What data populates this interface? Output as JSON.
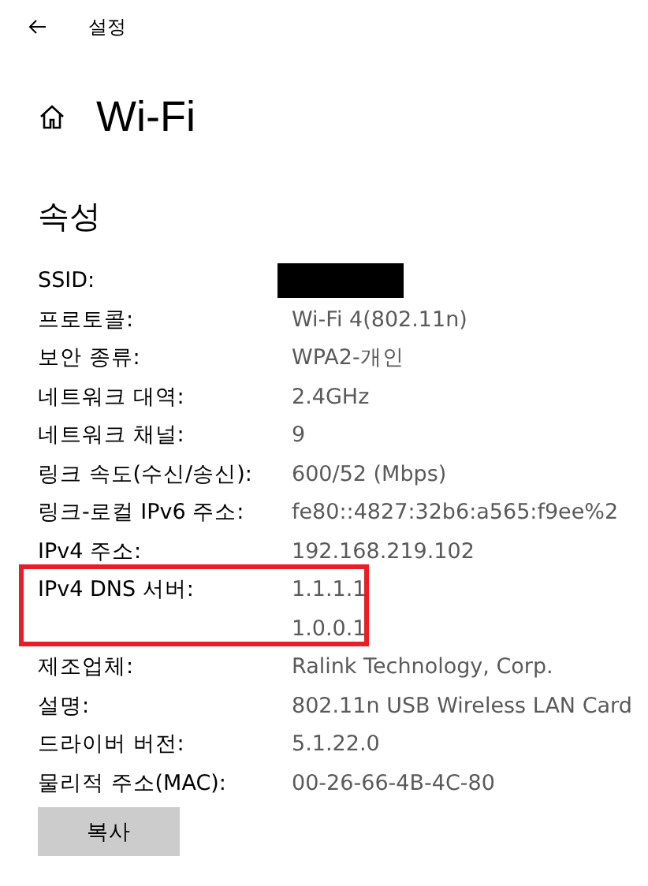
{
  "header": {
    "title": "설정"
  },
  "page": {
    "title": "Wi-Fi"
  },
  "section": {
    "title": "속성"
  },
  "properties": [
    {
      "label": "SSID:",
      "redacted": true,
      "highlighted": false
    },
    {
      "label": "프로토콜:",
      "values": [
        "Wi-Fi 4(802.11n)"
      ],
      "redacted": false,
      "highlighted": false
    },
    {
      "label": "보안 종류:",
      "values": [
        "WPA2-개인"
      ],
      "redacted": false,
      "highlighted": false
    },
    {
      "label": "네트워크 대역:",
      "values": [
        "2.4GHz"
      ],
      "redacted": false,
      "highlighted": false
    },
    {
      "label": "네트워크 채널:",
      "values": [
        "9"
      ],
      "redacted": false,
      "highlighted": false
    },
    {
      "label": "링크 속도(수신/송신):",
      "values": [
        "600/52 (Mbps)"
      ],
      "redacted": false,
      "highlighted": false
    },
    {
      "label": "링크-로컬 IPv6 주소:",
      "values": [
        "fe80::4827:32b6:a565:f9ee%2"
      ],
      "redacted": false,
      "highlighted": false
    },
    {
      "label": "IPv4 주소:",
      "values": [
        "192.168.219.102"
      ],
      "redacted": false,
      "highlighted": false
    },
    {
      "label": "IPv4 DNS 서버:",
      "values": [
        "1.1.1.1",
        "1.0.0.1"
      ],
      "redacted": false,
      "highlighted": true
    },
    {
      "label": "제조업체:",
      "values": [
        "Ralink Technology, Corp."
      ],
      "redacted": false,
      "highlighted": false
    },
    {
      "label": "설명:",
      "values": [
        "802.11n USB Wireless LAN Card"
      ],
      "redacted": false,
      "highlighted": false
    },
    {
      "label": "드라이버 버전:",
      "values": [
        "5.1.22.0"
      ],
      "redacted": false,
      "highlighted": false
    },
    {
      "label": "물리적 주소(MAC):",
      "values": [
        "00-26-66-4B-4C-80"
      ],
      "redacted": false,
      "highlighted": false
    }
  ],
  "buttons": [
    "복사"
  ]
}
